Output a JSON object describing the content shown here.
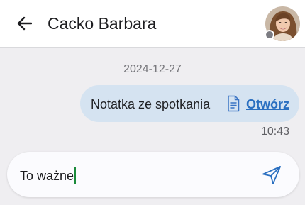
{
  "header": {
    "title": "Cacko Barbara",
    "back_icon": "arrow-left-icon",
    "status": "offline"
  },
  "conversation": {
    "date_separator": "2024-12-27",
    "messages": [
      {
        "text": "Notatka ze spotkania",
        "attachment_icon": "document-icon",
        "link_label": "Otwórz",
        "time": "10:43",
        "direction": "outgoing"
      }
    ]
  },
  "composer": {
    "value": "To ważne",
    "send_icon": "send-icon"
  },
  "colors": {
    "accent": "#2a6fc0",
    "bubble": "#d5e3f1",
    "background": "#efeef1",
    "caret": "#1a8a3a"
  }
}
